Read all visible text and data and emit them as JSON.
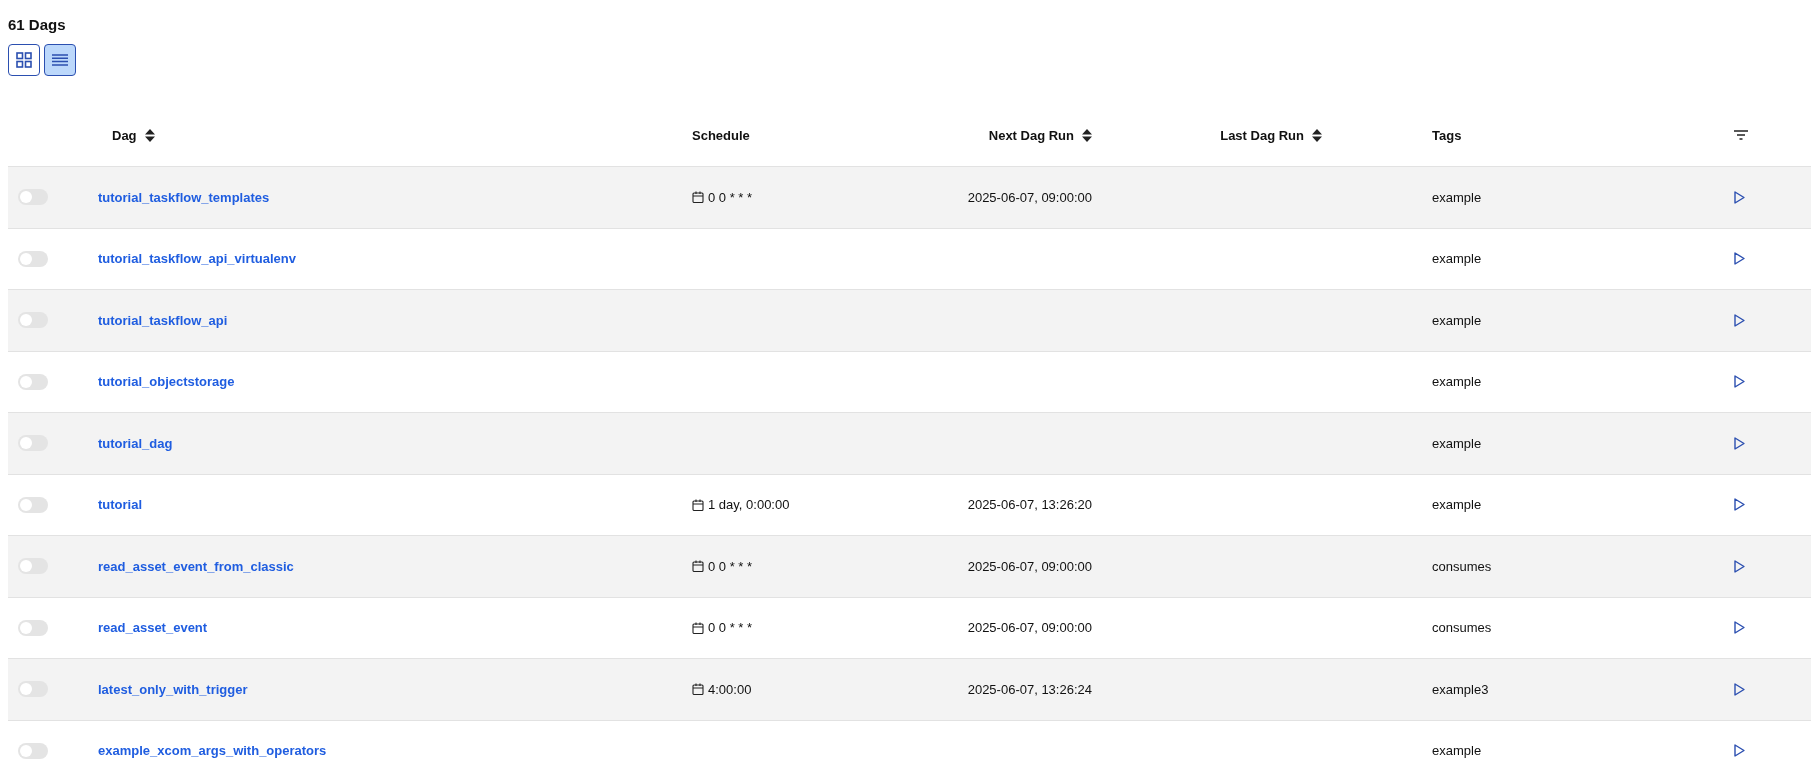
{
  "title": "61 Dags",
  "view_toggle": [
    {
      "kind": "grid",
      "selected": false
    },
    {
      "kind": "list",
      "selected": true
    }
  ],
  "table": {
    "columns": [
      {
        "label": "Dag",
        "sortable": true
      },
      {
        "label": "Schedule",
        "sortable": false
      },
      {
        "label": "Next Dag Run",
        "sortable": true
      },
      {
        "label": "Last Dag Run",
        "sortable": true
      },
      {
        "label": "Tags",
        "sortable": false
      }
    ],
    "rows": [
      {
        "on": false,
        "dag": "tutorial_taskflow_templates",
        "schedule": "0 0 * * *",
        "next_run": "2025-06-07, 09:00:00",
        "tag": "example"
      },
      {
        "on": false,
        "dag": "tutorial_taskflow_api_virtualenv",
        "tag": "example"
      },
      {
        "on": false,
        "dag": "tutorial_taskflow_api",
        "tag": "example"
      },
      {
        "on": false,
        "dag": "tutorial_objectstorage",
        "tag": "example"
      },
      {
        "on": false,
        "dag": "tutorial_dag",
        "tag": "example"
      },
      {
        "on": false,
        "dag": "tutorial",
        "schedule": "1 day, 0:00:00",
        "next_run": "2025-06-07, 13:26:20",
        "tag": "example"
      },
      {
        "on": false,
        "dag": "read_asset_event_from_classic",
        "schedule": "0 0 * * *",
        "next_run": "2025-06-07, 09:00:00",
        "tag": "consumes"
      },
      {
        "on": false,
        "dag": "read_asset_event",
        "schedule": "0 0 * * *",
        "next_run": "2025-06-07, 09:00:00",
        "tag": "consumes"
      },
      {
        "on": false,
        "dag": "latest_only_with_trigger",
        "schedule": "4:00:00",
        "next_run": "2025-06-07, 13:26:24",
        "tag": "example3"
      },
      {
        "on": false,
        "dag": "example_xcom_args_with_operators",
        "tag": "example"
      }
    ]
  }
}
